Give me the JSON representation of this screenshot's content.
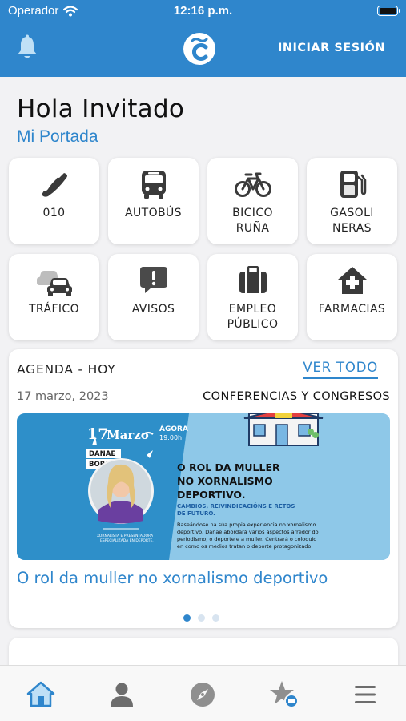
{
  "status": {
    "carrier": "Operador",
    "time": "12:16 p.m."
  },
  "header": {
    "login_label": "INICIAR SESIÓN",
    "logo_letter": "c"
  },
  "greeting": {
    "title": "Hola Invitado",
    "subtitle": "Mi Portada"
  },
  "tiles": [
    {
      "icon": "phone-icon",
      "label": "010"
    },
    {
      "icon": "bus-icon",
      "label": "AUTOBÚS"
    },
    {
      "icon": "bicycle-icon",
      "label": "BICICO\nRUÑA"
    },
    {
      "icon": "gas-pump-icon",
      "label": "GASOLI\nNERAS"
    },
    {
      "icon": "traffic-cars-icon",
      "label": "TRÁFICO"
    },
    {
      "icon": "alert-message-icon",
      "label": "AVISOS"
    },
    {
      "icon": "briefcase-icon",
      "label": "EMPLEO\nPÚBLICO"
    },
    {
      "icon": "pharmacy-house-icon",
      "label": "FARMACIAS"
    }
  ],
  "agenda": {
    "heading": "AGENDA - HOY",
    "see_all": "VER TODO",
    "date": "17 marzo, 2023",
    "category": "CONFERENCIAS Y CONGRESOS",
    "event_title": "O rol da muller no xornalismo deportivo",
    "banner": {
      "day": "17",
      "month": "Marzo",
      "venue": "ÁGORA",
      "hour": "19:00h",
      "speaker_first": "DANAE",
      "speaker_last": "BORONAT",
      "speaker_role_1": "XORNALISTA E PRESENTADORA",
      "speaker_role_2": "ESPECIALIZADA EN DEPORTE.",
      "headline_1": "O ROL DA MULLER",
      "headline_2": "NO XORNALISMO",
      "headline_3": "DEPORTIVO.",
      "subhead_1": "CAMBIOS, REIVINDICACIÓNS E RETOS",
      "subhead_2": "DE FUTURO.",
      "body_1": "Baseándose na súa propia experiencia no xornalismo",
      "body_2": "deportivo, Danae abordará varios aspectos arredor do",
      "body_3": "periodismo, o deporte e a muller. Centrará o coloquio",
      "body_4": "en como os medios tratan o deporte protagonizado"
    },
    "pager": {
      "count": 3,
      "active": 1
    }
  },
  "tabbar": [
    "home-icon",
    "user-icon",
    "compass-icon",
    "favorites-icon",
    "menu-icon"
  ],
  "colors": {
    "primary": "#2f86cc",
    "background": "#f2f2f4",
    "banner": "#8ec8e8"
  }
}
